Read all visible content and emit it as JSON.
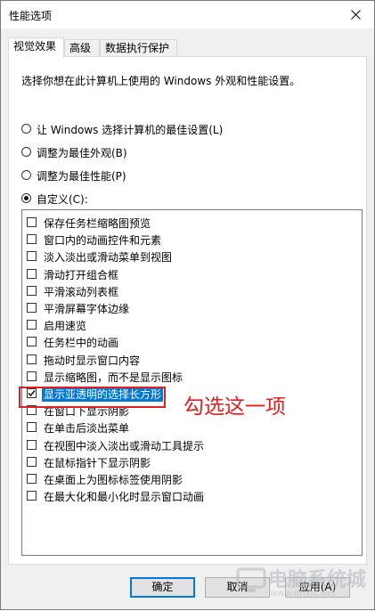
{
  "window": {
    "title": "性能选项"
  },
  "tabs": [
    {
      "label": "视觉效果",
      "active": true
    },
    {
      "label": "高级",
      "active": false
    },
    {
      "label": "数据执行保护",
      "active": false
    }
  ],
  "description": "选择你想在此计算机上使用的 Windows 外观和性能设置。",
  "radios": [
    {
      "label": "让 Windows 选择计算机的最佳设置(L)",
      "checked": false
    },
    {
      "label": "调整为最佳外观(B)",
      "checked": false
    },
    {
      "label": "调整为最佳性能(P)",
      "checked": false
    },
    {
      "label": "自定义(C):",
      "checked": true
    }
  ],
  "options": [
    {
      "label": "保存任务栏缩略图预览",
      "checked": false
    },
    {
      "label": "窗口内的动画控件和元素",
      "checked": false
    },
    {
      "label": "淡入淡出或滑动菜单到视图",
      "checked": false
    },
    {
      "label": "滑动打开组合框",
      "checked": false
    },
    {
      "label": "平滑滚动列表框",
      "checked": false
    },
    {
      "label": "平滑屏幕字体边缘",
      "checked": false
    },
    {
      "label": "启用速览",
      "checked": false
    },
    {
      "label": "任务栏中的动画",
      "checked": false
    },
    {
      "label": "拖动时显示窗口内容",
      "checked": false
    },
    {
      "label": "显示缩略图，而不是显示图标",
      "checked": false
    },
    {
      "label": "显示亚透明的选择长方形",
      "checked": true,
      "selected": true
    },
    {
      "label": "在窗口下显示阴影",
      "checked": false
    },
    {
      "label": "在单击后淡出菜单",
      "checked": false
    },
    {
      "label": "在视图中淡入淡出或滑动工具提示",
      "checked": false
    },
    {
      "label": "在鼠标指针下显示阴影",
      "checked": false
    },
    {
      "label": "在桌面上为图标标签使用阴影",
      "checked": false
    },
    {
      "label": "在最大化和最小化时显示窗口动画",
      "checked": false
    }
  ],
  "annotation": "勾选这一项",
  "buttons": {
    "ok": "确定",
    "cancel": "取消",
    "apply": "应用(A)"
  },
  "watermark": {
    "text": "电脑系统城",
    "sub": "www.dnxtc.net"
  },
  "colors": {
    "accent": "#0078d7",
    "annotation": "#e02020"
  }
}
